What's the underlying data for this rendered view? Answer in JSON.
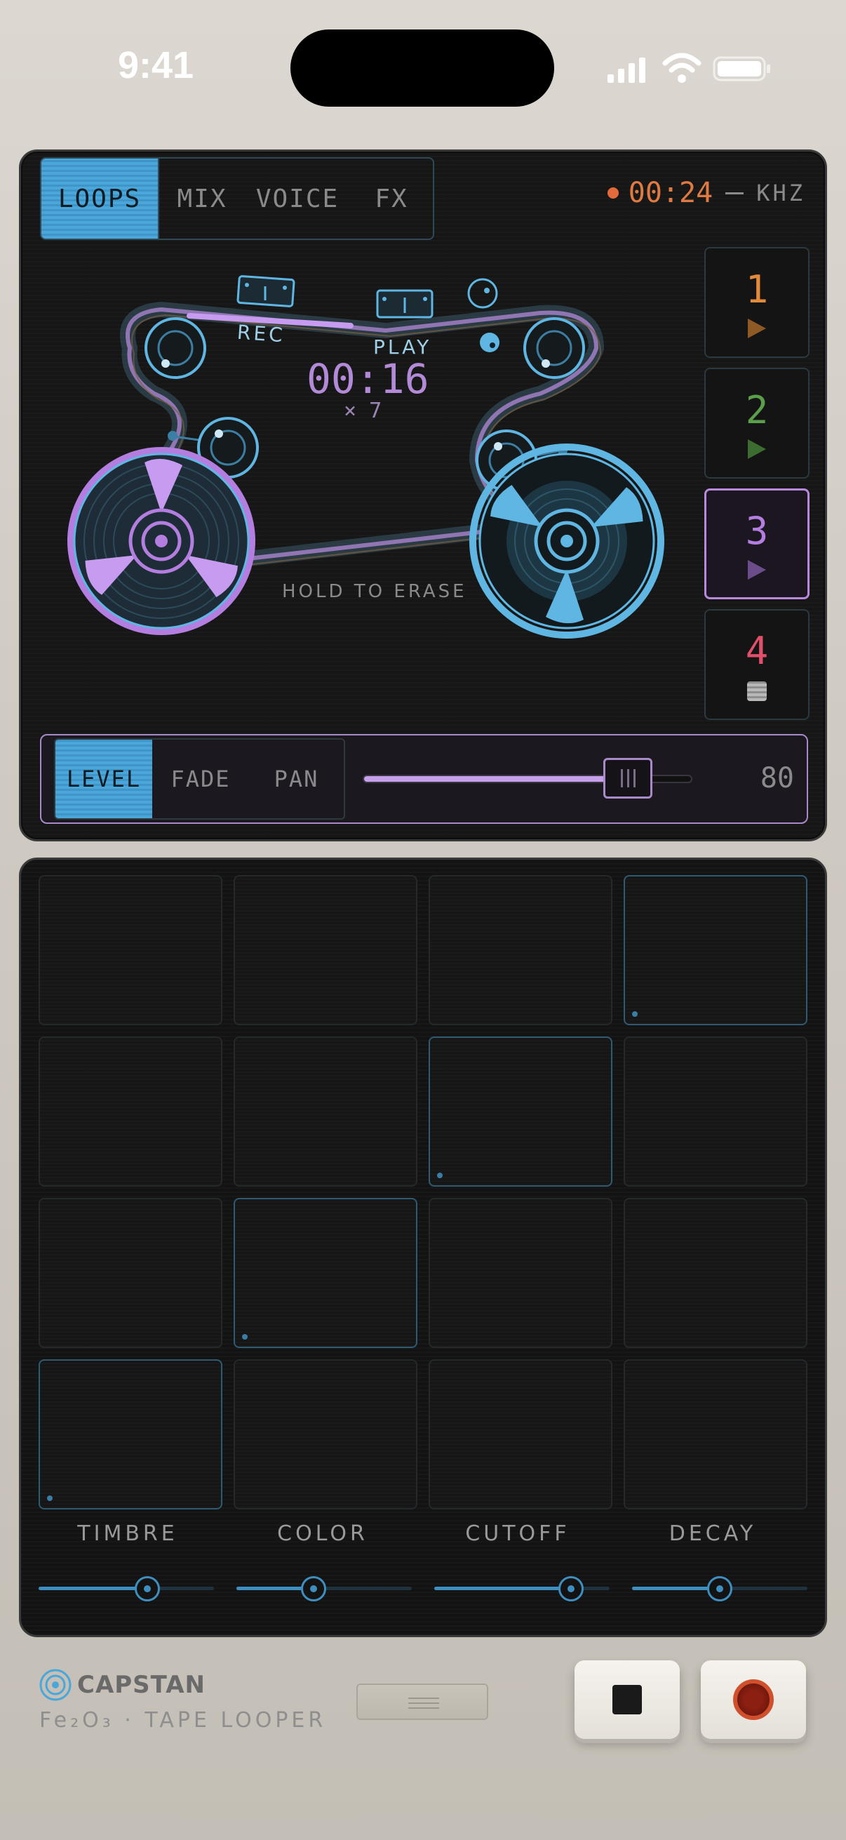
{
  "status_bar": {
    "time": "9:41"
  },
  "tabs": [
    {
      "label": "LOOPS",
      "active": true
    },
    {
      "label": "MIX",
      "active": false
    },
    {
      "label": "VOICE",
      "active": false
    },
    {
      "label": "FX",
      "active": false
    }
  ],
  "recording": {
    "elapsed": "00:24",
    "unit": "KHZ"
  },
  "tape": {
    "rec_label": "REC",
    "play_label": "PLAY",
    "loop_time": "00:16",
    "multiplier": "× 7",
    "hint": "HOLD TO ERASE"
  },
  "tracks": [
    {
      "number": "1",
      "color": "#e08a3a",
      "state": "play"
    },
    {
      "number": "2",
      "color": "#5aa04a",
      "state": "play"
    },
    {
      "number": "3",
      "color": "#b47ee0",
      "state": "play",
      "selected": true
    },
    {
      "number": "4",
      "color": "#e0506a",
      "state": "stop"
    }
  ],
  "level_panel": {
    "tabs": [
      {
        "label": "LEVEL",
        "active": true
      },
      {
        "label": "FADE",
        "active": false
      },
      {
        "label": "PAN",
        "active": false
      }
    ],
    "value": "80",
    "value_fraction": 0.8
  },
  "pads": {
    "rows": 4,
    "cols": 4,
    "lit": [
      3,
      6,
      9,
      12
    ]
  },
  "knobs": [
    {
      "label": "TIMBRE",
      "value": 0.62
    },
    {
      "label": "COLOR",
      "value": 0.44
    },
    {
      "label": "CUTOFF",
      "value": 0.78
    },
    {
      "label": "DECAY",
      "value": 0.5
    }
  ],
  "footer": {
    "brand": "CAPSTAN",
    "subtitle": "Fe₂O₃ · TAPE LOOPER"
  },
  "colors": {
    "accent_blue": "#4ba6d9",
    "accent_purple": "#b47ee0",
    "rec_orange": "#e07a43"
  }
}
